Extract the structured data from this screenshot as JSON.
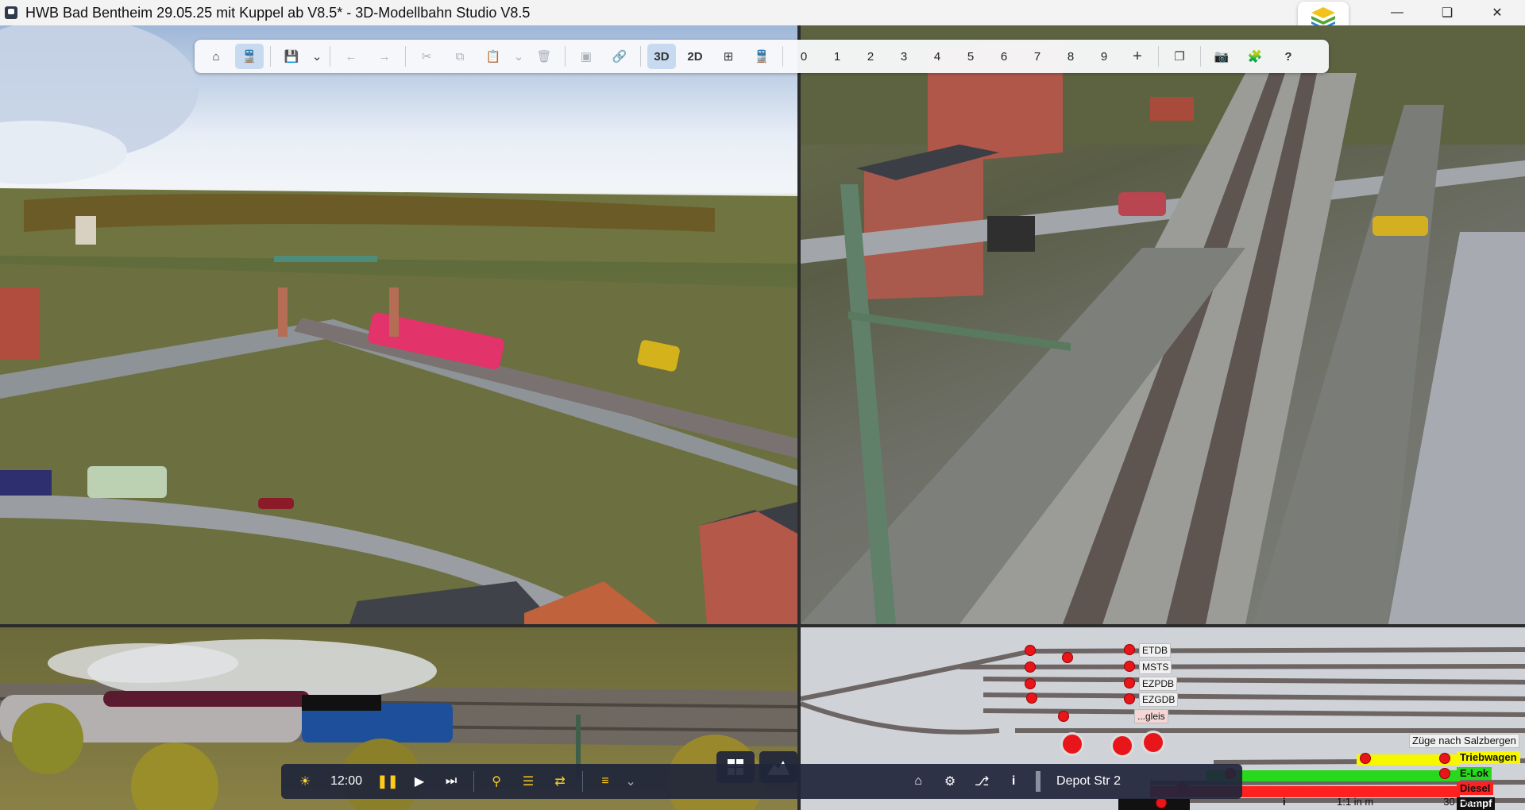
{
  "window": {
    "title": "HWB Bad Bentheim 29.05.25 mit Kuppel ab V8.5* - 3D-Modellbahn Studio V8.5",
    "controls": [
      "minimize-icon",
      "maximize-icon",
      "close-icon"
    ]
  },
  "toolbar": {
    "buttons": [
      {
        "name": "home-icon",
        "active": false
      },
      {
        "name": "train-icon",
        "active": true
      },
      {
        "name": "save-icon",
        "active": false
      },
      {
        "name": "undo-icon",
        "active": false
      },
      {
        "name": "redo-icon",
        "active": false
      },
      {
        "name": "cut-icon",
        "active": false
      },
      {
        "name": "copy-icon",
        "active": false
      },
      {
        "name": "paste-icon",
        "active": false
      },
      {
        "name": "delete-icon",
        "active": false
      },
      {
        "name": "group-icon",
        "active": false
      },
      {
        "name": "link-icon",
        "active": false
      }
    ],
    "view_3d": "3D",
    "view_2d": "2D",
    "numbers": [
      "0",
      "1",
      "2",
      "3",
      "4",
      "5",
      "6",
      "7",
      "8",
      "9"
    ],
    "right_icons": [
      "plus-icon",
      "window-icon",
      "camera-icon",
      "puzzle-icon",
      "help-icon"
    ],
    "help": "?"
  },
  "bottom_bar": {
    "time": "12:00",
    "icons": [
      "sun-icon",
      "pause-icon",
      "play-icon",
      "step-icon",
      "search-icon",
      "layers-icon",
      "shuffle-icon",
      "list-icon"
    ],
    "right_icons": [
      "home-icon",
      "gear-icon",
      "route-icon",
      "info-icon"
    ],
    "location_label": "Depot Str 2"
  },
  "track_panel": {
    "labels": [
      "ETDB",
      "MSTS",
      "EZPDB",
      "EZGDB",
      "...gleis"
    ],
    "zuege_label": "Züge nach Salzbergen",
    "legend": [
      {
        "text": "Triebwagen",
        "color": "#f7f700"
      },
      {
        "text": "E-Lok",
        "color": "#27d81c"
      },
      {
        "text": "Diesel",
        "color": "#ff2020"
      },
      {
        "text": "Dampf",
        "color": "#111111"
      }
    ],
    "scale_text": "1:1 in m",
    "fps_text": "30 FPS"
  },
  "colors": {
    "toolbar_active": "#c8daf0",
    "bottombar_bg": "#20263a",
    "signal_red": "#e8161a"
  }
}
